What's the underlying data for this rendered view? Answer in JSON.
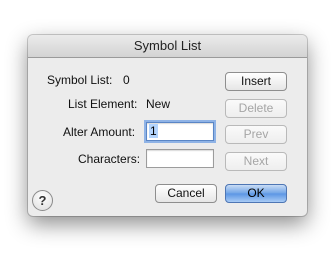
{
  "window": {
    "title": "Symbol List"
  },
  "fields": {
    "symbol_list_label": "Symbol List:",
    "symbol_list_value": "0",
    "list_element_label": "List Element:",
    "list_element_value": "New",
    "alter_amount_label": "Alter Amount:",
    "alter_amount_value": "1",
    "characters_label": "Characters:",
    "characters_value": ""
  },
  "buttons": {
    "insert": "Insert",
    "delete": "Delete",
    "prev": "Prev",
    "next": "Next",
    "cancel": "Cancel",
    "ok": "OK",
    "help": "?"
  },
  "colors": {
    "dialog_bg": "#ececec",
    "default_button": "#5a95e4",
    "disabled_text": "#a5a5a5",
    "focus_ring": "#8fb3e6"
  }
}
